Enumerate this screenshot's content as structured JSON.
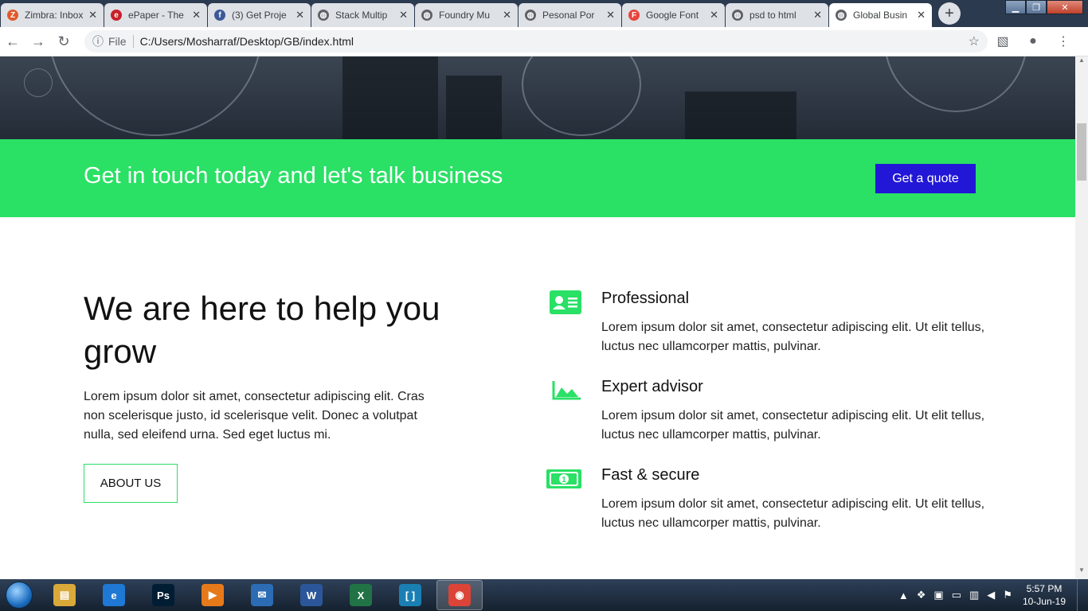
{
  "browser": {
    "tabs": [
      {
        "label": "Zimbra: Inbox",
        "icon": "zimbra-icon",
        "color": "#e05a2a",
        "glyph": "Z"
      },
      {
        "label": "ePaper - The",
        "icon": "epaper-icon",
        "color": "#c8202a",
        "glyph": "e"
      },
      {
        "label": "(3) Get Proje",
        "icon": "facebook-icon",
        "color": "#3b5998",
        "glyph": "f"
      },
      {
        "label": "Stack Multip",
        "icon": "globe-icon",
        "color": "#5f6368",
        "glyph": "◍"
      },
      {
        "label": "Foundry Mu",
        "icon": "globe-icon",
        "color": "#5f6368",
        "glyph": "◍"
      },
      {
        "label": "Pesonal Por",
        "icon": "globe-icon",
        "color": "#5f6368",
        "glyph": "◍"
      },
      {
        "label": "Google Font",
        "icon": "google-fonts-icon",
        "color": "#e8453c",
        "glyph": "F"
      },
      {
        "label": "psd to html",
        "icon": "globe-icon",
        "color": "#5f6368",
        "glyph": "◍"
      },
      {
        "label": "Global Busin",
        "icon": "globe-icon",
        "color": "#5f6368",
        "glyph": "◍",
        "active": true
      }
    ],
    "close_glyph": "✕",
    "new_tab_glyph": "+",
    "window_controls": {
      "minimize": "▁",
      "maximize": "❐",
      "close": "✕"
    },
    "address": {
      "info_glyph": "ⓘ",
      "scheme_label": "File",
      "url": "C:/Users/Mosharraf/Desktop/GB/index.html",
      "star_glyph": "☆"
    },
    "nav": {
      "back": "←",
      "forward": "→",
      "reload": "↻"
    },
    "toolbar": {
      "pdf": "▧",
      "profile": "●",
      "menu": "⋮"
    }
  },
  "page": {
    "cta": {
      "heading": "Get in touch today and let's talk business",
      "button": "Get a quote",
      "bg_color": "#2ae065",
      "button_color": "#2217d6"
    },
    "about": {
      "title": "We are here to help you grow",
      "text": "Lorem ipsum dolor sit amet, consectetur adipiscing elit. Cras non scelerisque justo, id scelerisque velit. Donec a volutpat nulla, sed eleifend urna. Sed eget luctus mi.",
      "button": "ABOUT US"
    },
    "features": [
      {
        "title": "Professional",
        "text": "Lorem ipsum dolor sit amet, consectetur adipiscing elit. Ut elit tellus, luctus nec ullamcorper mattis, pulvinar.",
        "icon": "id-card-icon"
      },
      {
        "title": "Expert advisor",
        "text": "Lorem ipsum dolor sit amet, consectetur adipiscing elit. Ut elit tellus, luctus nec ullamcorper mattis, pulvinar.",
        "icon": "area-chart-icon"
      },
      {
        "title": "Fast & secure",
        "text": "Lorem ipsum dolor sit amet, consectetur adipiscing elit. Ut elit tellus, luctus nec ullamcorper mattis, pulvinar.",
        "icon": "money-bill-icon"
      }
    ],
    "accent_color": "#2ae065"
  },
  "taskbar": {
    "apps": [
      {
        "name": "file-explorer-icon",
        "color": "#d9a93a",
        "glyph": "▤"
      },
      {
        "name": "internet-explorer-icon",
        "color": "#1e78d4",
        "glyph": "e"
      },
      {
        "name": "photoshop-icon",
        "color": "#001d34",
        "glyph": "Ps"
      },
      {
        "name": "media-player-icon",
        "color": "#e67a1a",
        "glyph": "▶"
      },
      {
        "name": "thunderbird-icon",
        "color": "#2b6cb5",
        "glyph": "✉"
      },
      {
        "name": "word-icon",
        "color": "#2b579a",
        "glyph": "W"
      },
      {
        "name": "excel-icon",
        "color": "#217346",
        "glyph": "X"
      },
      {
        "name": "brackets-icon",
        "color": "#1a7fb3",
        "glyph": "[ ]"
      },
      {
        "name": "chrome-icon",
        "color": "#db4437",
        "glyph": "◉",
        "active": true
      }
    ],
    "tray": {
      "time": "5:57 PM",
      "date": "10-Jun-19"
    }
  }
}
